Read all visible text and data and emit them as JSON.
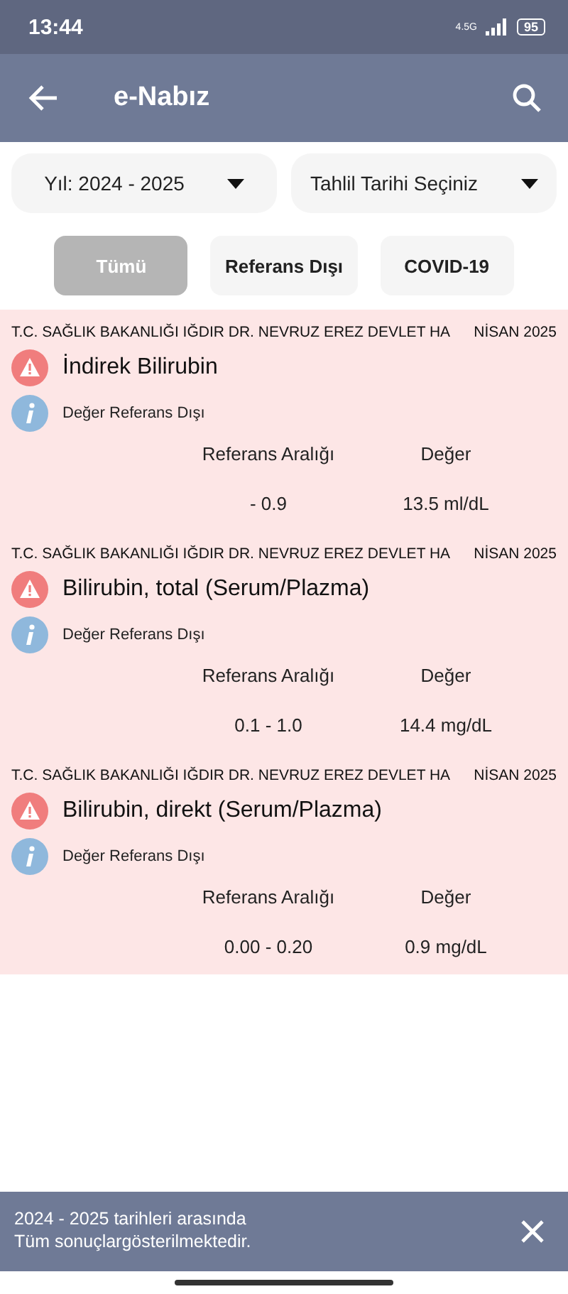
{
  "status_bar": {
    "time": "13:44",
    "network": "4.5G",
    "battery": "95"
  },
  "app_bar": {
    "title": "e-Nabız"
  },
  "filters": [
    {
      "label": "Yıl: 2024 - 2025"
    },
    {
      "label": "Tahlil Tarihi Seçiniz"
    }
  ],
  "tabs": [
    {
      "label": "Tümü",
      "selected": true
    },
    {
      "label": "Referans Dışı",
      "selected": false
    },
    {
      "label": "COVID-19",
      "selected": false
    }
  ],
  "results": [
    {
      "hospital": "T.C. SAĞLIK BAKANLIĞI IĞDIR DR. NEVRUZ EREZ DEVLET HA",
      "date": "NİSAN 2025",
      "test": "İndirek Bilirubin",
      "status": "Değer Referans Dışı",
      "range_label": "Referans Aralığı",
      "value_label": "Değer",
      "range": "- 0.9",
      "value": "13.5 ml/dL"
    },
    {
      "hospital": "T.C. SAĞLIK BAKANLIĞI IĞDIR DR. NEVRUZ EREZ DEVLET HA",
      "date": "NİSAN 2025",
      "test": "Bilirubin, total (Serum/Plazma)",
      "status": "Değer Referans Dışı",
      "range_label": "Referans Aralığı",
      "value_label": "Değer",
      "range": "0.1 - 1.0",
      "value": "14.4 mg/dL"
    },
    {
      "hospital": "T.C. SAĞLIK BAKANLIĞI IĞDIR DR. NEVRUZ EREZ DEVLET HA",
      "date": "NİSAN 2025",
      "test": "Bilirubin, direkt (Serum/Plazma)",
      "status": "Değer Referans Dışı",
      "range_label": "Referans Aralığı",
      "value_label": "Değer",
      "range": "0.00 - 0.20",
      "value": "0.9 mg/dL"
    }
  ],
  "snackbar": {
    "message": "2024 - 2025 tarihleri arasında Tüm sonuçlargösterilmektedir."
  }
}
